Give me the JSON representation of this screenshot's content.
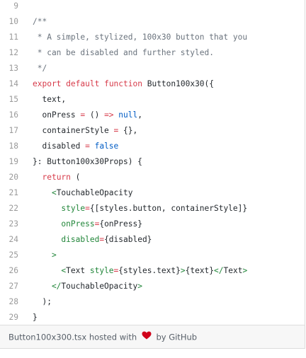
{
  "code": {
    "lines": [
      {
        "num": "9",
        "tokens": []
      },
      {
        "num": "10",
        "tokens": [
          {
            "t": "/**",
            "c": "cmt"
          }
        ]
      },
      {
        "num": "11",
        "tokens": [
          {
            "t": " * A simple, stylized, 100x30 button that you",
            "c": "cmt"
          }
        ]
      },
      {
        "num": "12",
        "tokens": [
          {
            "t": " * can be disabled and further styled.",
            "c": "cmt"
          }
        ]
      },
      {
        "num": "13",
        "tokens": [
          {
            "t": " */",
            "c": "cmt"
          }
        ]
      },
      {
        "num": "14",
        "tokens": [
          {
            "t": "export",
            "c": "kw"
          },
          {
            "t": " ",
            "c": "pln"
          },
          {
            "t": "default",
            "c": "kw"
          },
          {
            "t": " ",
            "c": "pln"
          },
          {
            "t": "function",
            "c": "kw"
          },
          {
            "t": " ",
            "c": "pln"
          },
          {
            "t": "Button100x30",
            "c": "fn"
          },
          {
            "t": "({",
            "c": "pln"
          }
        ]
      },
      {
        "num": "15",
        "tokens": [
          {
            "t": "  text,",
            "c": "pln"
          }
        ]
      },
      {
        "num": "16",
        "tokens": [
          {
            "t": "  onPress ",
            "c": "pln"
          },
          {
            "t": "=",
            "c": "op"
          },
          {
            "t": " () ",
            "c": "pln"
          },
          {
            "t": "=>",
            "c": "op"
          },
          {
            "t": " ",
            "c": "pln"
          },
          {
            "t": "null",
            "c": "cst"
          },
          {
            "t": ",",
            "c": "pln"
          }
        ]
      },
      {
        "num": "17",
        "tokens": [
          {
            "t": "  containerStyle ",
            "c": "pln"
          },
          {
            "t": "=",
            "c": "op"
          },
          {
            "t": " {},",
            "c": "pln"
          }
        ]
      },
      {
        "num": "18",
        "tokens": [
          {
            "t": "  disabled ",
            "c": "pln"
          },
          {
            "t": "=",
            "c": "op"
          },
          {
            "t": " ",
            "c": "pln"
          },
          {
            "t": "false",
            "c": "cst"
          }
        ]
      },
      {
        "num": "19",
        "tokens": [
          {
            "t": "}: Button100x30Props) {",
            "c": "pln"
          }
        ]
      },
      {
        "num": "20",
        "tokens": [
          {
            "t": "  ",
            "c": "pln"
          },
          {
            "t": "return",
            "c": "kw"
          },
          {
            "t": " (",
            "c": "pln"
          }
        ]
      },
      {
        "num": "21",
        "tokens": [
          {
            "t": "    <",
            "c": "tag"
          },
          {
            "t": "TouchableOpacity",
            "c": "pln"
          }
        ]
      },
      {
        "num": "22",
        "tokens": [
          {
            "t": "      ",
            "c": "pln"
          },
          {
            "t": "style",
            "c": "tag"
          },
          {
            "t": "=",
            "c": "op"
          },
          {
            "t": "{[styles.button, containerStyle]}",
            "c": "pln"
          }
        ]
      },
      {
        "num": "23",
        "tokens": [
          {
            "t": "      ",
            "c": "pln"
          },
          {
            "t": "onPress",
            "c": "tag"
          },
          {
            "t": "=",
            "c": "op"
          },
          {
            "t": "{onPress}",
            "c": "pln"
          }
        ]
      },
      {
        "num": "24",
        "tokens": [
          {
            "t": "      ",
            "c": "pln"
          },
          {
            "t": "disabled",
            "c": "tag"
          },
          {
            "t": "=",
            "c": "op"
          },
          {
            "t": "{disabled}",
            "c": "pln"
          }
        ]
      },
      {
        "num": "25",
        "tokens": [
          {
            "t": "    >",
            "c": "tag"
          }
        ]
      },
      {
        "num": "26",
        "tokens": [
          {
            "t": "      <",
            "c": "tag"
          },
          {
            "t": "Text",
            "c": "pln"
          },
          {
            "t": " ",
            "c": "pln"
          },
          {
            "t": "style",
            "c": "tag"
          },
          {
            "t": "=",
            "c": "op"
          },
          {
            "t": "{styles.text}",
            "c": "pln"
          },
          {
            "t": ">",
            "c": "tag"
          },
          {
            "t": "{text}",
            "c": "pln"
          },
          {
            "t": "</",
            "c": "tag"
          },
          {
            "t": "Text",
            "c": "pln"
          },
          {
            "t": ">",
            "c": "tag"
          }
        ]
      },
      {
        "num": "27",
        "tokens": [
          {
            "t": "    </",
            "c": "tag"
          },
          {
            "t": "TouchableOpacity",
            "c": "pln"
          },
          {
            "t": ">",
            "c": "tag"
          }
        ]
      },
      {
        "num": "28",
        "tokens": [
          {
            "t": "  );",
            "c": "pln"
          }
        ]
      },
      {
        "num": "29",
        "tokens": [
          {
            "t": "}",
            "c": "pln"
          }
        ]
      }
    ]
  },
  "footer": {
    "filename": "Button100x300.tsx",
    "hosted_text": "hosted with",
    "by_text": "by",
    "host_link": "GitHub",
    "heart_color": "#d0021b"
  }
}
